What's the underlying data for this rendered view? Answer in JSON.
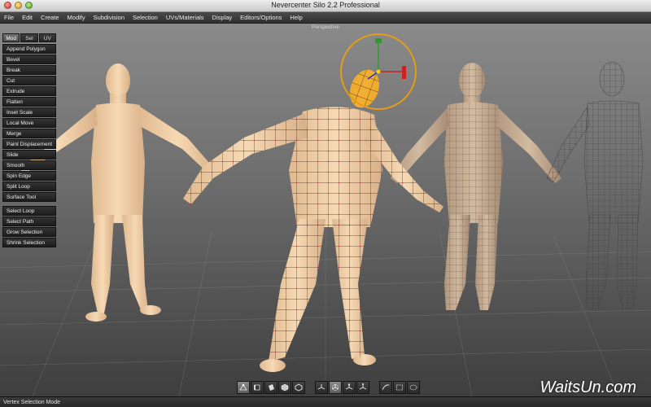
{
  "window": {
    "title": "Nevercenter Silo 2.2 Professional"
  },
  "menubar": {
    "items": [
      "File",
      "Edit",
      "Create",
      "Modify",
      "Subdivision",
      "Selection",
      "UVs/Materials",
      "Display",
      "Editors/Options",
      "Help"
    ]
  },
  "viewport": {
    "label": "Perspective"
  },
  "panel": {
    "tabs": [
      "Mod",
      "Sel",
      "UV"
    ],
    "active_tab": "Mod",
    "tools": [
      "Append Polygon",
      "Bevel",
      "Break",
      "Cut",
      "Extrude",
      "Flatten",
      "Inset Scale",
      "Local Move",
      "Merge",
      "Paint Displacement",
      "Slide",
      "Smooth",
      "Spin Edge",
      "Split Loop",
      "Surface Tool"
    ],
    "selection_tools": [
      "Select Loop",
      "Select Path",
      "Grow Selection",
      "Shrink Selection"
    ]
  },
  "toolbar": {
    "icons": [
      "vertex-select-icon",
      "edge-select-icon",
      "face-select-icon",
      "object-select-icon",
      "solid-mode-icon",
      "move-manipulator-icon",
      "rotate-manipulator-icon",
      "scale-manipulator-icon",
      "universal-manipulator-icon",
      "paint-select-icon",
      "box-select-icon",
      "lasso-select-icon"
    ]
  },
  "status": {
    "text": "Vertex Selection Mode"
  },
  "watermark": {
    "text": "WaitsUn.com"
  },
  "colors": {
    "skin": "#f2d2aa",
    "selection": "#e8a31a",
    "vertex": "#cc1f1f",
    "menu_bg": "#3a3a3a"
  }
}
